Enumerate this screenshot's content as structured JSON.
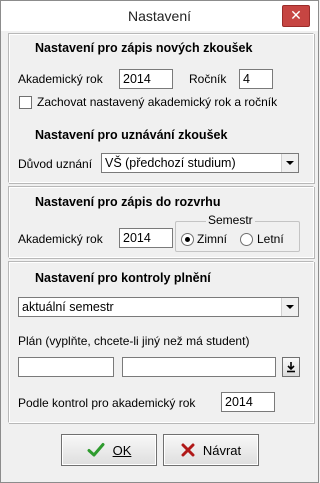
{
  "window": {
    "title": "Nastavení",
    "close_glyph": "✕"
  },
  "section_new_exams": {
    "title": "Nastavení pro zápis nových zkoušek",
    "academic_year_label": "Akademický rok",
    "academic_year_value": "2014",
    "grade_label": "Ročník",
    "grade_value": "4",
    "keep_label": "Zachovat nastavený akademický rok a ročník",
    "keep_checked": false
  },
  "section_recognition": {
    "title": "Nastavení pro uznávání zkoušek",
    "reason_label": "Důvod uznání",
    "reason_value": "VŠ (předchozí studium)"
  },
  "section_schedule": {
    "title": "Nastavení pro zápis do rozvrhu",
    "academic_year_label": "Akademický rok",
    "academic_year_value": "2014",
    "semester_group_label": "Semestr",
    "winter_label": "Zimní",
    "summer_label": "Letní",
    "selected_semester": "winter"
  },
  "section_control": {
    "title": "Nastavení pro kontroly plnění",
    "scope_value": "aktuální semestr",
    "plan_label": "Plán (vyplňte, chcete-li jiný než má student)",
    "plan_code_value": "",
    "plan_name_value": "",
    "year_label": "Podle kontrol pro akademický rok",
    "year_value": "2014"
  },
  "buttons": {
    "ok_label": "OK",
    "back_label": "Návrat"
  },
  "icons": {
    "ok": "check-icon",
    "back": "x-mark-icon",
    "browse": "download-arrow-icon"
  },
  "colors": {
    "ok_icon": "#2e9b2e",
    "back_icon": "#b01818",
    "close_button": "#c64542"
  }
}
